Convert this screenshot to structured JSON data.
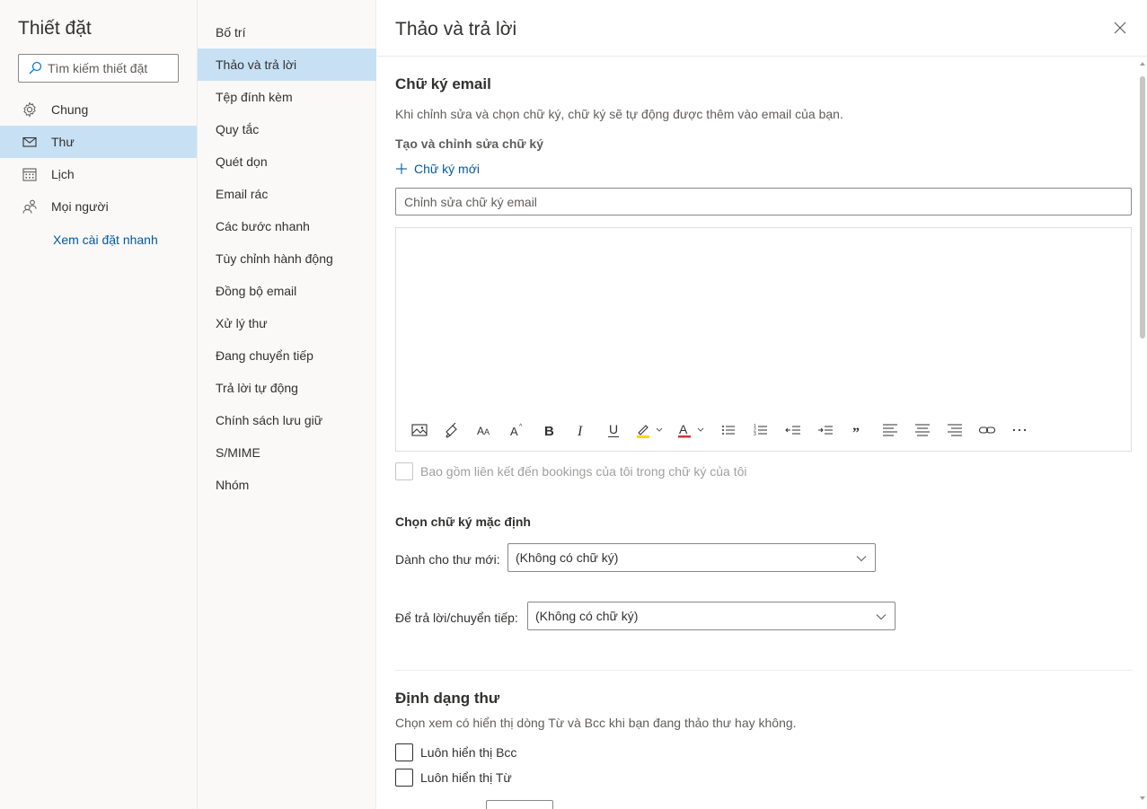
{
  "settings": {
    "title": "Thiết đặt",
    "search_placeholder": "Tìm kiếm thiết đặt",
    "nav": [
      {
        "label": "Chung",
        "icon": "gear-icon"
      },
      {
        "label": "Thư",
        "icon": "mail-icon",
        "active": true
      },
      {
        "label": "Lịch",
        "icon": "calendar-icon"
      },
      {
        "label": "Mọi người",
        "icon": "people-icon"
      }
    ],
    "quick_settings_link": "Xem cài đặt nhanh"
  },
  "mail_menu": {
    "items": [
      "Bố trí",
      "Thảo và trả lời",
      "Tệp đính kèm",
      "Quy tắc",
      "Quét dọn",
      "Email rác",
      "Các bước nhanh",
      "Tùy chỉnh hành động",
      "Đồng bộ email",
      "Xử lý thư",
      "Đang chuyển tiếp",
      "Trả lời tự động",
      "Chính sách lưu giữ",
      "S/MIME",
      "Nhóm"
    ],
    "active_index": 1
  },
  "panel": {
    "title": "Thảo và trả lời",
    "signature": {
      "section_title": "Chữ ký email",
      "description": "Khi chỉnh sửa và chọn chữ ký, chữ ký sẽ tự động được thêm vào email của bạn.",
      "create_label": "Tạo và chỉnh sửa chữ ký",
      "new_signature": "Chữ ký mới",
      "name_placeholder": "Chỉnh sửa chữ ký email",
      "bookings_label": "Bao gồm liên kết đến bookings của tôi trong chữ ký của tôi"
    },
    "default_signature": {
      "section_title": "Chọn chữ ký mặc định",
      "new_messages_label": "Dành cho thư mới:",
      "new_messages_value": "(Không có chữ ký)",
      "replies_label": "Để trả lời/chuyển tiếp:",
      "replies_value": "(Không có chữ ký)"
    },
    "message_format": {
      "section_title": "Định dạng thư",
      "description": "Chọn xem có hiển thị dòng Từ và Bcc khi bạn đang thảo thư hay không.",
      "always_bcc": "Luôn hiển thị Bcc",
      "always_from": "Luôn hiển thị Từ"
    }
  },
  "toolbar_icons": [
    "insert-picture-icon",
    "format-painter-icon",
    "font-size-icon",
    "superscript-icon",
    "bold-icon",
    "italic-icon",
    "underline-icon",
    "highlight-icon",
    "font-color-icon",
    "bullets-icon",
    "numbering-icon",
    "decrease-indent-icon",
    "increase-indent-icon",
    "quote-icon",
    "align-left-icon",
    "align-center-icon",
    "align-right-icon",
    "link-icon",
    "more-icon"
  ],
  "colors": {
    "accent": "#005a9e",
    "selected_bg": "#c7e0f4",
    "pane_bg": "#faf9f8",
    "highlight_yellow": "#ffd600",
    "font_color_red": "#d13438"
  }
}
